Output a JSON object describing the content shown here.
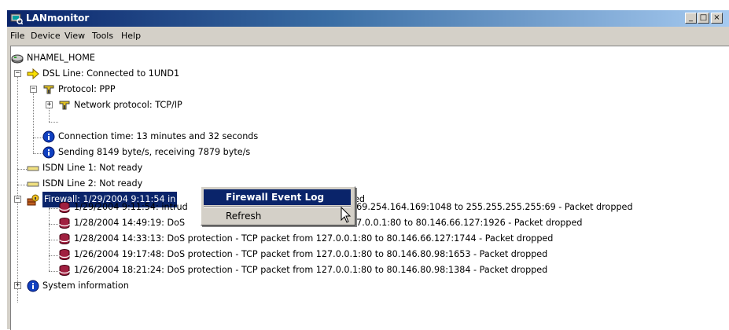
{
  "window": {
    "title": "LANmonitor",
    "controls": {
      "minimize": "_",
      "maximize": "□",
      "close": "×"
    }
  },
  "menu": [
    "File",
    "Device",
    "View",
    "Tools",
    "Help"
  ],
  "tree": {
    "root": "NHAMEL_HOME",
    "dsl": "DSL Line: Connected to 1UND1",
    "protocol": "Protocol: PPP",
    "network_protocol": "Network protocol: TCP/IP",
    "connection_time": "Connection time: 13 minutes and 32 seconds",
    "sending": "Sending 8149 byte/s, receiving 7879 byte/s",
    "isdn1": "ISDN Line 1: Not ready",
    "isdn2": "ISDN Line 2: Not ready",
    "firewall": "Firewall: 1/29/2004 9:11:54 in",
    "firewall_tail": "ed",
    "events": [
      {
        "left": "1/29/2004 9:11:54: intrud",
        "right": "169.254.164.169:1048 to 255.255.255.255:69 - Packet dropped"
      },
      {
        "left": "1/28/2004 14:49:19: DoS",
        "right": "27.0.0.1:80 to 80.146.66.127:1926 - Packet dropped"
      },
      {
        "text": "1/28/2004 14:33:13: DoS protection - TCP packet from 127.0.0.1:80 to 80.146.66.127:1744 - Packet dropped"
      },
      {
        "text": "1/26/2004 19:17:48: DoS protection - TCP packet from 127.0.0.1:80 to 80.146.80.98:1653 - Packet dropped"
      },
      {
        "text": "1/26/2004 18:21:24: DoS protection - TCP packet from 127.0.0.1:80 to 80.146.80.98:1384 - Packet dropped"
      }
    ],
    "system_information": "System information"
  },
  "context_menu": {
    "items": [
      "Firewall Event Log",
      "Refresh"
    ],
    "highlighted": "Firewall Event Log"
  },
  "colors": {
    "titlebar_start": "#0a246a",
    "titlebar_end": "#a6caf0",
    "selection": "#0a246a",
    "face": "#d4d0c8"
  }
}
